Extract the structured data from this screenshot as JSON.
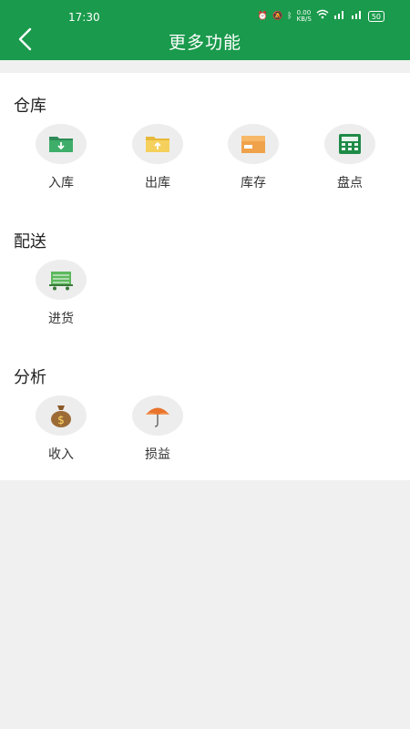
{
  "status_bar": {
    "time": "17:30",
    "net_speed": "0.00\nKB/S",
    "battery": "50"
  },
  "header": {
    "title": "更多功能",
    "back_icon": "chevron-left-icon"
  },
  "sections": [
    {
      "title": "仓库",
      "items": [
        {
          "label": "入库",
          "icon": "folder-download-icon"
        },
        {
          "label": "出库",
          "icon": "folder-upload-icon"
        },
        {
          "label": "库存",
          "icon": "box-icon"
        },
        {
          "label": "盘点",
          "icon": "calculator-icon"
        }
      ]
    },
    {
      "title": "配送",
      "items": [
        {
          "label": "进货",
          "icon": "cart-icon"
        }
      ]
    },
    {
      "title": "分析",
      "items": [
        {
          "label": "收入",
          "icon": "money-bag-icon"
        },
        {
          "label": "损益",
          "icon": "umbrella-icon"
        }
      ]
    }
  ],
  "colors": {
    "primary": "#1a9a4c",
    "background": "#f0f0f0",
    "panel": "#ffffff"
  }
}
